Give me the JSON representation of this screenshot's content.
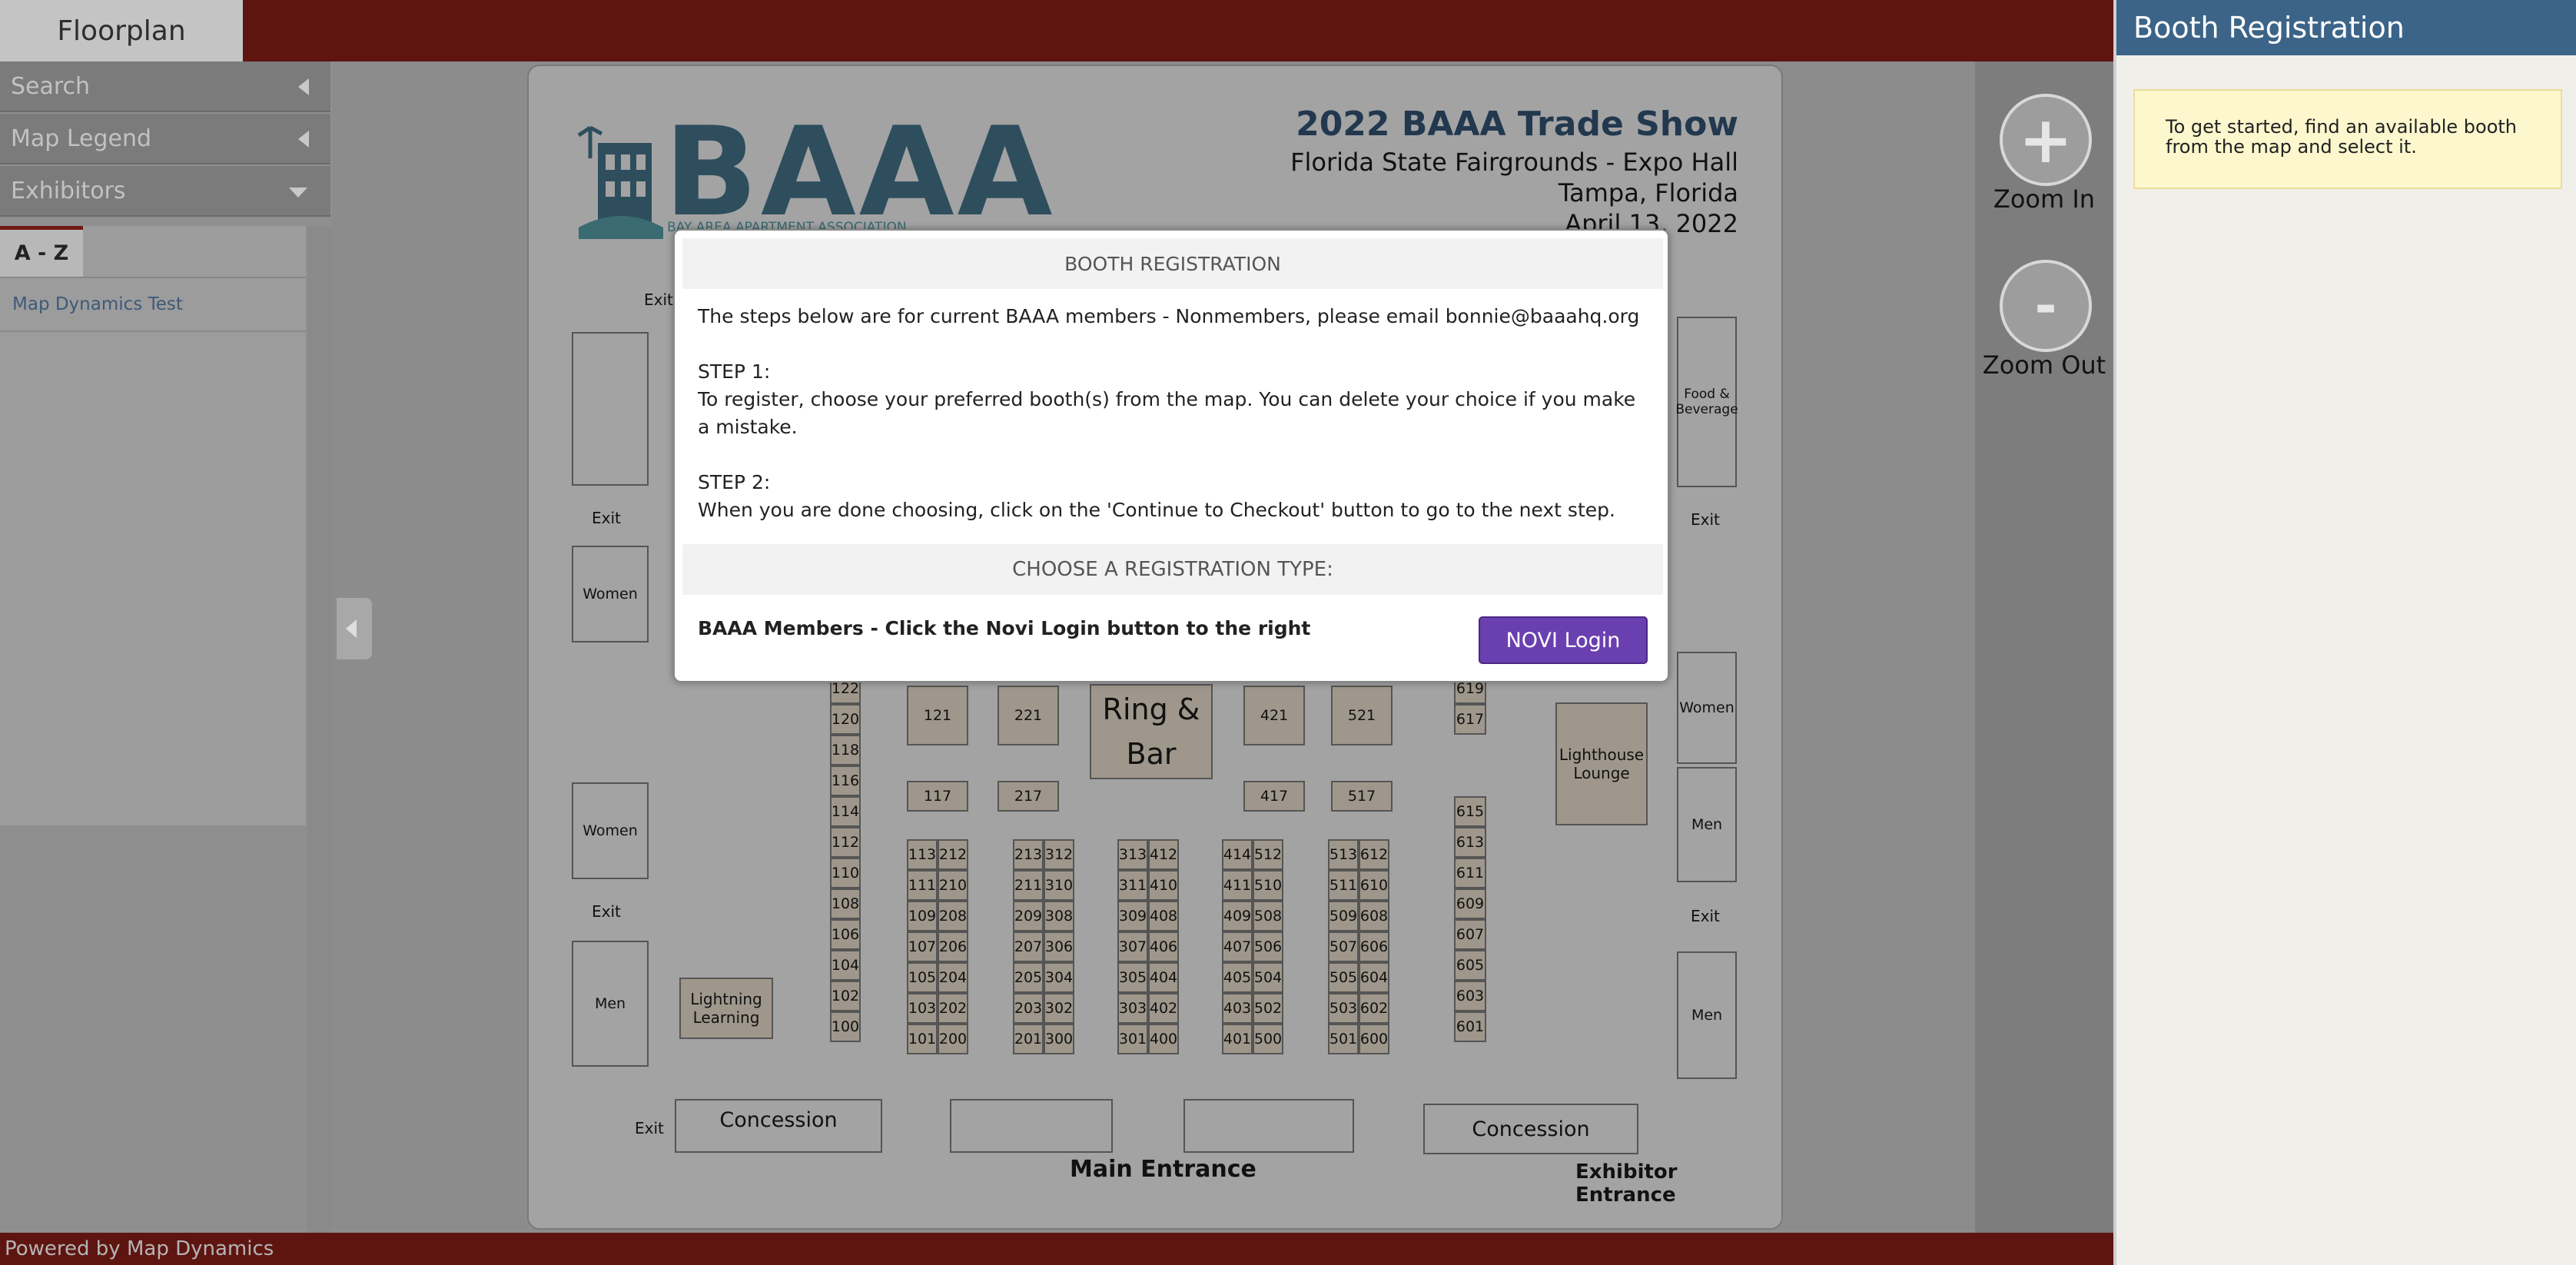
{
  "app": {
    "tab_label": "Floorplan",
    "footer_text": "Powered by Map Dynamics"
  },
  "sidebar": {
    "search_label": "Search",
    "legend_label": "Map Legend",
    "exhibitors_label": "Exhibitors",
    "az_tab": "A - Z",
    "exhibitors": [
      "Map Dynamics Test"
    ]
  },
  "zoom": {
    "in_symbol": "+",
    "in_label": "Zoom In",
    "out_symbol": "-",
    "out_label": "Zoom Out"
  },
  "right_panel": {
    "title": "Booth Registration",
    "info": "To get started, find an available booth from the map and select it."
  },
  "floorplan": {
    "logo_text": "BAAA",
    "logo_subtext": "BAY AREA APARTMENT ASSOCIATION",
    "title": "2022 BAAA Trade Show",
    "venue": "Florida State Fairgrounds - Expo Hall",
    "city": "Tampa, Florida",
    "date": "April 13, 2022",
    "labels": {
      "exit": "Exit",
      "women": "Women",
      "men": "Men",
      "food": "Food & Beverage",
      "ring_bar": "Ring & Bar",
      "lighthouse": "Lighthouse Lounge",
      "lightning": "Lightning Learning",
      "concession": "Concession",
      "main_entrance": "Main Entrance",
      "exhibitor_entrance": "Exhibitor Entrance"
    },
    "booths": {
      "col_100": [
        "122",
        "120",
        "118",
        "116",
        "114",
        "112",
        "110",
        "108",
        "106",
        "104",
        "102",
        "100"
      ],
      "block_1": [
        [
          "113",
          "212"
        ],
        [
          "111",
          "210"
        ],
        [
          "109",
          "208"
        ],
        [
          "107",
          "206"
        ],
        [
          "105",
          "204"
        ],
        [
          "103",
          "202"
        ],
        [
          "101",
          "200"
        ]
      ],
      "block_2": [
        [
          "213",
          "312"
        ],
        [
          "211",
          "310"
        ],
        [
          "209",
          "308"
        ],
        [
          "207",
          "306"
        ],
        [
          "205",
          "304"
        ],
        [
          "203",
          "302"
        ],
        [
          "201",
          "300"
        ]
      ],
      "block_3": [
        [
          "313",
          "412"
        ],
        [
          "311",
          "410"
        ],
        [
          "309",
          "408"
        ],
        [
          "307",
          "406"
        ],
        [
          "305",
          "404"
        ],
        [
          "303",
          "402"
        ],
        [
          "301",
          "400"
        ]
      ],
      "block_4": [
        [
          "414",
          "512"
        ],
        [
          "411",
          "510"
        ],
        [
          "409",
          "508"
        ],
        [
          "407",
          "506"
        ],
        [
          "405",
          "504"
        ],
        [
          "403",
          "502"
        ],
        [
          "401",
          "500"
        ]
      ],
      "block_5": [
        [
          "513",
          "612"
        ],
        [
          "511",
          "610"
        ],
        [
          "509",
          "608"
        ],
        [
          "507",
          "606"
        ],
        [
          "505",
          "604"
        ],
        [
          "503",
          "602"
        ],
        [
          "501",
          "600"
        ]
      ],
      "col_600": [
        "615",
        "613",
        "611",
        "609",
        "607",
        "605",
        "603",
        "601"
      ],
      "col_617": [
        "619",
        "617"
      ],
      "squares": [
        "121",
        "221",
        "421",
        "521"
      ],
      "small": [
        "117",
        "217",
        "417",
        "517"
      ]
    }
  },
  "modal": {
    "title": "BOOTH REGISTRATION",
    "intro": "The steps below are for current BAAA members - Nonmembers, please email bonnie@baaahq.org",
    "step1_title": "STEP 1:",
    "step1_text": "To register, choose your preferred booth(s) from the map. You can delete your choice if you make a mistake.",
    "step2_title": "STEP 2:",
    "step2_text": "When you are done choosing, click on the 'Continue to Checkout' button to go to the next step.",
    "choose_heading": "CHOOSE A REGISTRATION TYPE:",
    "members_text": "BAAA Members - Click the Novi Login button to the right",
    "login_button": "NOVI Login"
  },
  "colors": {
    "brand_maroon": "#5e1510",
    "panel_header": "#3c6488",
    "info_box": "#fdf7cd",
    "login_button": "#6a3fb0",
    "booth_fill": "#9f978b"
  }
}
